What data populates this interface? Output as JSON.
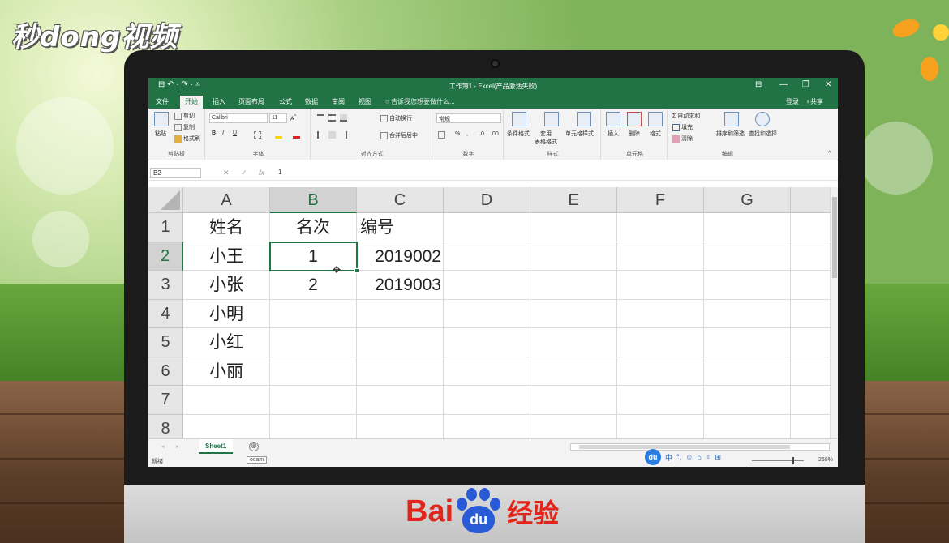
{
  "watermark": "秒dong视频",
  "brand": {
    "bai": "Bai",
    "du": "du",
    "jy": "经验"
  },
  "excel": {
    "title": "工作簿1 - Excel(产品激活失败)",
    "quick_access": "⊟  ↶ · ↷ · ⩡",
    "window_buttons": [
      "⊟",
      "—",
      "❐",
      "✕"
    ],
    "tabs": [
      "文件",
      "开始",
      "插入",
      "页面布局",
      "公式",
      "数据",
      "审阅",
      "视图"
    ],
    "active_tab": "开始",
    "tell_me": "告诉我您想要做什么...",
    "login": "登录",
    "share": "♀共享",
    "ribbon": {
      "clipboard": {
        "paste": "粘贴",
        "cut": "剪切",
        "copy": "复制",
        "format_painter": "格式刷",
        "label": "剪贴板"
      },
      "font": {
        "name": "Calibri",
        "size": "11",
        "bold": "B",
        "italic": "I",
        "underline": "U",
        "label": "字体"
      },
      "alignment": {
        "wrap": "自动换行",
        "merge": "合并后居中",
        "label": "对齐方式"
      },
      "number": {
        "format": "常规",
        "percent": "%",
        "comma": ",",
        "label": "数字"
      },
      "styles": {
        "conditional": "条件格式",
        "table_format": "套用\n表格格式",
        "cell_styles": "单元格样式",
        "label": "样式"
      },
      "cells": {
        "insert": "插入",
        "delete": "删除",
        "format": "格式",
        "label": "单元格"
      },
      "editing": {
        "autosum": "自动求和",
        "fill": "填充",
        "clear": "清除",
        "sort": "排序和筛选",
        "find": "查找和选择",
        "label": "编辑"
      }
    },
    "formula_bar": {
      "name_box": "B2",
      "fx": "fx",
      "value": "1"
    },
    "columns": [
      "A",
      "B",
      "C",
      "D",
      "E",
      "F",
      "G"
    ],
    "rows": [
      "1",
      "2",
      "3",
      "4",
      "5",
      "6",
      "7",
      "8"
    ],
    "cells": {
      "A1": "姓名",
      "B1": "名次",
      "C1": "编号",
      "A2": "小王",
      "B2": "1",
      "C2": "2019002",
      "A3": "小张",
      "B3": "2",
      "C3": "2019003",
      "A4": "小明",
      "A5": "小红",
      "A6": "小丽"
    },
    "active_cell": "B2",
    "sheet_tab": "Sheet1",
    "add_sheet": "⊕",
    "status": "就绪",
    "ocam": "ocam",
    "ime": [
      "中",
      "°,",
      "☺",
      "⌂",
      "♀",
      "⊞"
    ],
    "zoom": "268%"
  }
}
